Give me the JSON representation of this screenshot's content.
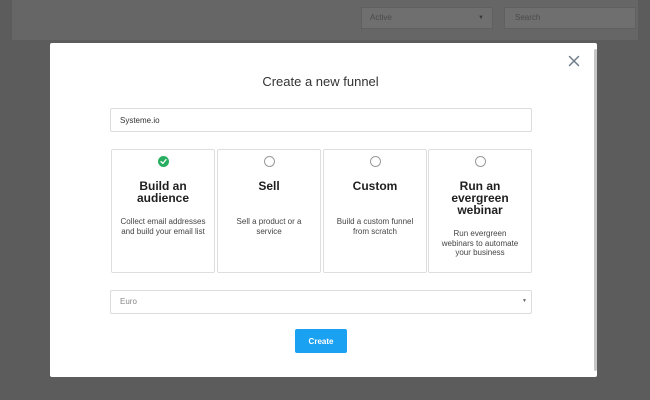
{
  "background": {
    "status_select_value": "Active",
    "search_placeholder": "Search"
  },
  "modal": {
    "title": "Create a new funnel",
    "name_input_value": "Systeme.io",
    "options": [
      {
        "title": "Build an audience",
        "description": "Collect email addresses and build your email list",
        "selected": true
      },
      {
        "title": "Sell",
        "description": "Sell a product or a service",
        "selected": false
      },
      {
        "title": "Custom",
        "description": "Build a custom funnel from scratch",
        "selected": false
      },
      {
        "title": "Run an evergreen webinar",
        "description": "Run evergreen webinars to automate your business",
        "selected": false
      }
    ],
    "currency_value": "Euro",
    "create_label": "Create",
    "colors": {
      "accent": "#1ba1f2",
      "selected": "#27ae60",
      "overlay": "#5c5c5c"
    },
    "icons": {
      "close": "close-icon",
      "check": "check-icon",
      "select_caret": "caret-down-icon"
    }
  }
}
